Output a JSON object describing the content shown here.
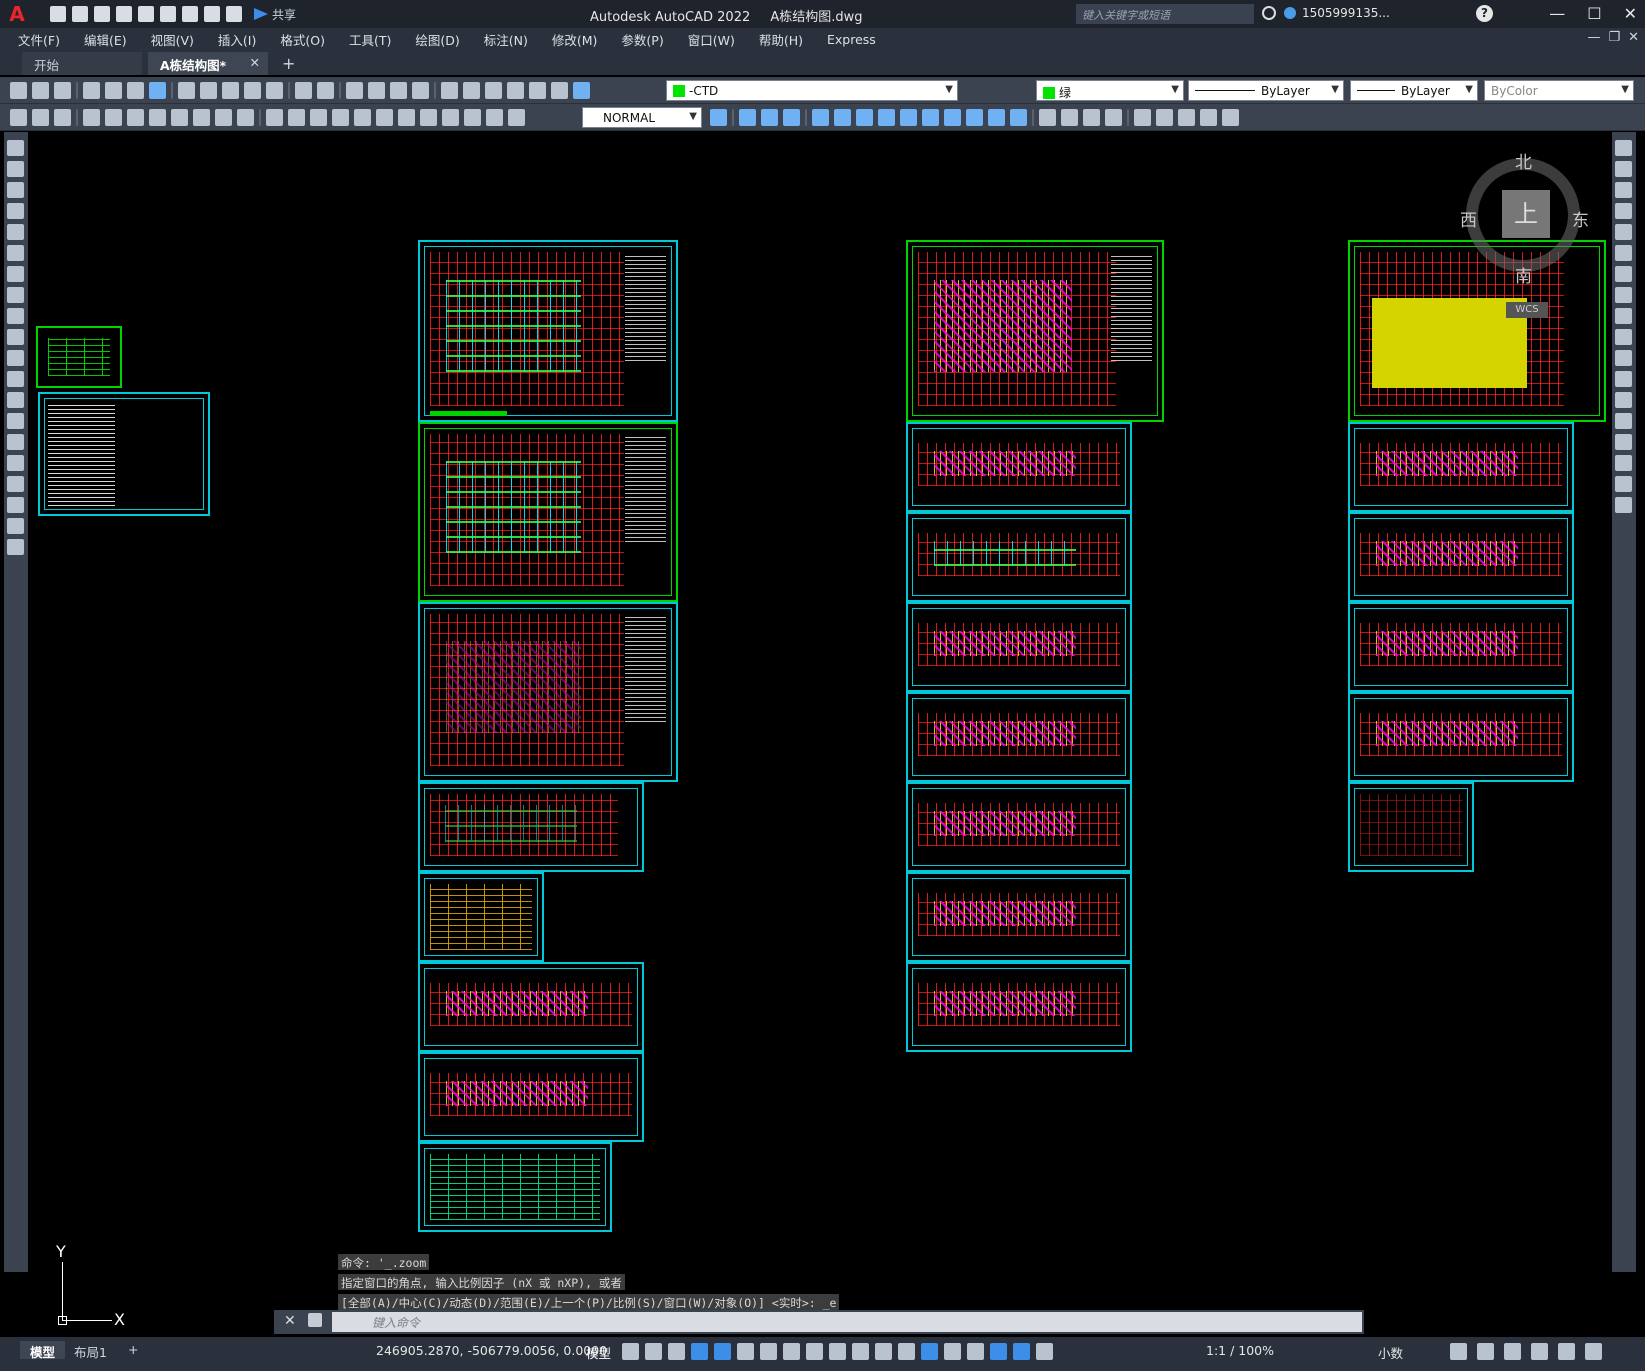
{
  "app": {
    "logo": "A",
    "title": "Autodesk AutoCAD 2022",
    "filename": "A栋结构图.dwg",
    "share_label": "共享",
    "search_placeholder": "键入关键字或短语",
    "user": "1505999135...",
    "help_label": "?"
  },
  "menu": [
    "文件(F)",
    "编辑(E)",
    "视图(V)",
    "插入(I)",
    "格式(O)",
    "工具(T)",
    "绘图(D)",
    "标注(N)",
    "修改(M)",
    "参数(P)",
    "窗口(W)",
    "帮助(H)",
    "Express"
  ],
  "tabs": {
    "start": "开始",
    "active": "A栋结构图*",
    "add": "+"
  },
  "properties": {
    "layer": "-CTD",
    "color": "绿",
    "color_hex": "#00e400",
    "linetype": "ByLayer",
    "lineweight": "ByLayer",
    "plotstyle": "ByColor",
    "dimstyle": "NORMAL"
  },
  "viewcube": {
    "north": "北",
    "south": "南",
    "east": "东",
    "west": "西",
    "face": "上",
    "wcs": "WCS"
  },
  "ucs": {
    "x": "X",
    "y": "Y"
  },
  "command": {
    "history": [
      "命令: '_.zoom",
      "指定窗口的角点, 输入比例因子 (nX 或 nXP), 或者",
      "[全部(A)/中心(C)/动态(D)/范围(E)/上一个(P)/比例(S)/窗口(W)/对象(O)] <实时>: _e"
    ],
    "placeholder": "键入命令"
  },
  "status": {
    "layout_tabs": [
      "模型",
      "布局1"
    ],
    "add_layout": "+",
    "coordinates": "246905.2870, -506779.0056, 0.0000",
    "space": "模型",
    "annotation_scale": "1:1 / 100%",
    "units": "小数"
  },
  "colors": {
    "sheet_frame": "#00c8d8",
    "sheet_frame_green": "#00d400",
    "grid_red": "#ff1e1e",
    "background": "#000000"
  }
}
